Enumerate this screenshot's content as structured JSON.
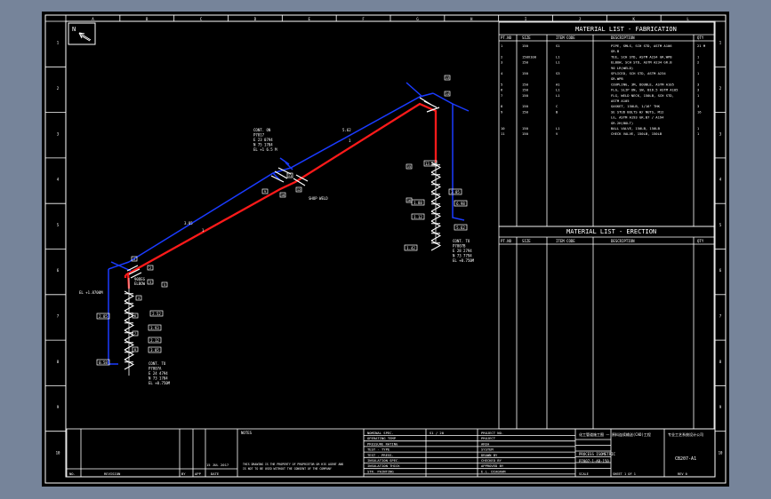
{
  "north_label": "N",
  "col_letters": [
    "A",
    "B",
    "C",
    "D",
    "E",
    "F",
    "G",
    "H",
    "I",
    "J",
    "K",
    "L"
  ],
  "row_numbers": [
    "1",
    "2",
    "3",
    "4",
    "5",
    "6",
    "7",
    "8",
    "9",
    "10"
  ],
  "fabrication": {
    "title": "MATERIAL LIST - FABRICATION",
    "headers": [
      "PT.NO",
      "SIZE",
      "ITEM CODE",
      "DESCRIPTION",
      "QTY"
    ],
    "rows": [
      [
        "1",
        "150",
        "S1",
        "PIPE, SMLS, SCH STD, ASTM A106",
        "21 M"
      ],
      [
        "",
        "",
        "",
        "GR.B",
        ""
      ],
      [
        "2",
        "150X100",
        "L1",
        "TEE, SCH STD, ASTM A234 GR.WPB",
        "1"
      ],
      [
        "3",
        "150",
        "L1",
        "ELBOW, SCH STD, ASTM A234 GR.B",
        "2"
      ],
      [
        "",
        "",
        "",
        "90 LR(WELD)",
        ""
      ],
      [
        "4",
        "150",
        "S3",
        "SPLICED, SCH STD, ASTM A234",
        "1"
      ],
      [
        "",
        "",
        "",
        "GR.WPB",
        ""
      ],
      [
        "5",
        "150",
        "A1",
        "COUPLING, 3M, DOUBLE, ASTM A105",
        "3"
      ],
      [
        "6",
        "150",
        "L1",
        "FLG, SLIP ON, SW, B16.5 ASTM A105",
        "3"
      ],
      [
        "7",
        "150",
        "L1",
        "FLG, WELD NECK, 150LB, SCH STD,",
        "1"
      ],
      [
        "",
        "",
        "",
        "ASTM A105",
        ""
      ],
      [
        "8",
        "150",
        "C",
        "GASKET, 150LB, 1/16\" THK",
        "3"
      ],
      [
        "9",
        "150",
        "B",
        "SE STUD BOLTS W/ NUTS, M12",
        "16"
      ],
      [
        "",
        "",
        "",
        "LG, ASTM A193 GR.B7 / A194",
        ""
      ],
      [
        "",
        "",
        "",
        "GR.2H(BOLT)",
        ""
      ],
      [
        "10",
        "150",
        "L1",
        "BALL VALVE, 150LB, 150LB",
        "1"
      ],
      [
        "11",
        "150",
        "V",
        "CHECK VALVE, 150LB, 150LB",
        "1"
      ]
    ]
  },
  "erection": {
    "title": "MATERIAL LIST - ERECTION",
    "headers": [
      "PT.NO",
      "SIZE",
      "ITEM CODE",
      "DESCRIPTION",
      "QTY"
    ]
  },
  "callouts": {
    "cont_top": [
      "CONT. ON",
      "P7817",
      "E 23 0794",
      "N 75 1704",
      "EL +1 6.5 M"
    ],
    "cont_left": [
      "CONT. TO",
      "P7807A",
      "E 24 4794",
      "N 73 1704",
      "EL +0.750M"
    ],
    "cont_right": [
      "CONT. TO",
      "P7807B",
      "E 28 2794",
      "N 73 7794",
      "EL +0.750M"
    ],
    "el_left": [
      "EL +1.8700M"
    ],
    "elbow_note": [
      "90DEG",
      "ELBOW"
    ],
    "weld_note": "SHOP WELD",
    "dims": [
      "2.52",
      "3.93",
      "2.12",
      "13.20",
      "3.85",
      "1.88",
      "6.98",
      "5.62",
      "1.12",
      "2.85",
      "3.85",
      "1.42",
      "0.58"
    ],
    "tags": [
      "1",
      "2",
      "3",
      "4",
      "5",
      "6",
      "7",
      "8",
      "9",
      "10",
      "11",
      "12",
      "13",
      "14",
      "15",
      "16"
    ]
  },
  "title_block": {
    "notes_label": "NOTES",
    "rev_headers": [
      "NO.",
      "REVISION",
      "BY",
      "APP",
      "DATE"
    ],
    "rev_date": "15 JUL 2017",
    "notice": "THIS DRAWING IS THE PROPERTY OF PROPRIETOR OR HIS AGENT AND",
    "notice2": "IS NOT TO BE USED WITHOUT THE CONSENT OF THE COMPANY",
    "design_labels": [
      "NOMINAL SPEC.",
      "OPERATING TEMP",
      "PRESSURE RATING",
      "TEST - TYPE",
      "TEST - PRESS.",
      "INSULATION SPEC.",
      "INSULATION THICK",
      "STR. PAINTING"
    ],
    "spec_value": "S1 / 20",
    "project_labels": [
      "PROJECT NO.",
      "PROJECT",
      "AREA",
      "SYSTEM",
      "DRAWN BY",
      "CHECKED BY",
      "APPROVED BY",
      "E.L. DIAGRAM"
    ],
    "company": "化工管道施工图 一 原料连续输送(CAD)工程",
    "company2": "专业工艺系统设计公司",
    "dwg_title": "PROCESS ISOMETRIC",
    "dwg_no": "P7807-1-AB-150",
    "line_no": "CB207-A1",
    "scale": "SCALE",
    "sheet": "SHEET 1 OF 1",
    "rev": "REV 0"
  }
}
